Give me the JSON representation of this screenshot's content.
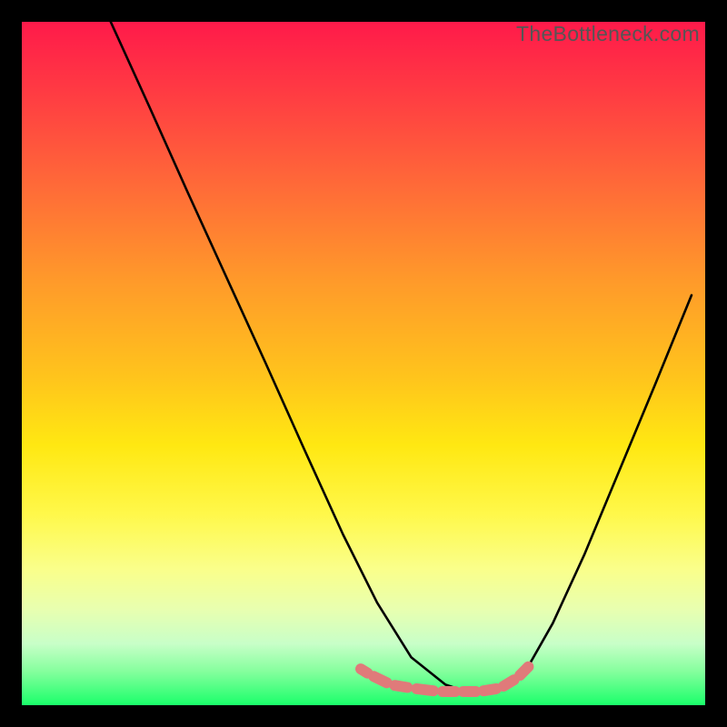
{
  "watermark": "TheBottleneck.com",
  "chart_data": {
    "type": "line",
    "title": "",
    "xlabel": "",
    "ylabel": "",
    "xlim": [
      0,
      100
    ],
    "ylim": [
      0,
      100
    ],
    "grid": false,
    "background": {
      "gradient": "vertical",
      "stops": [
        {
          "pos": 0.0,
          "color": "#ff1a4a"
        },
        {
          "pos": 0.5,
          "color": "#ffc41c"
        },
        {
          "pos": 0.8,
          "color": "#fff84a"
        },
        {
          "pos": 1.0,
          "color": "#1aff6a"
        }
      ]
    },
    "series": [
      {
        "name": "bottleneck-curve",
        "color": "#000000",
        "x": [
          13,
          18.7,
          24.3,
          30,
          35.7,
          41.3,
          47,
          52,
          57,
          62,
          65,
          68,
          71,
          74.3,
          77.7,
          82.3,
          87.3,
          92.7,
          98
        ],
        "values": [
          100,
          87.5,
          75,
          62.5,
          50,
          37.5,
          25,
          15,
          7,
          3,
          2,
          2,
          3,
          6,
          12,
          22,
          34,
          47,
          60
        ]
      },
      {
        "name": "highlight-segments",
        "color": "#e57373",
        "type": "scatter",
        "x": [
          49.3,
          50.9,
          54,
          57,
          61,
          64,
          67,
          70,
          72.5,
          74.5
        ],
        "values": [
          5.5,
          4.5,
          3,
          2.5,
          2,
          2,
          2,
          2.5,
          4,
          6
        ]
      }
    ]
  }
}
